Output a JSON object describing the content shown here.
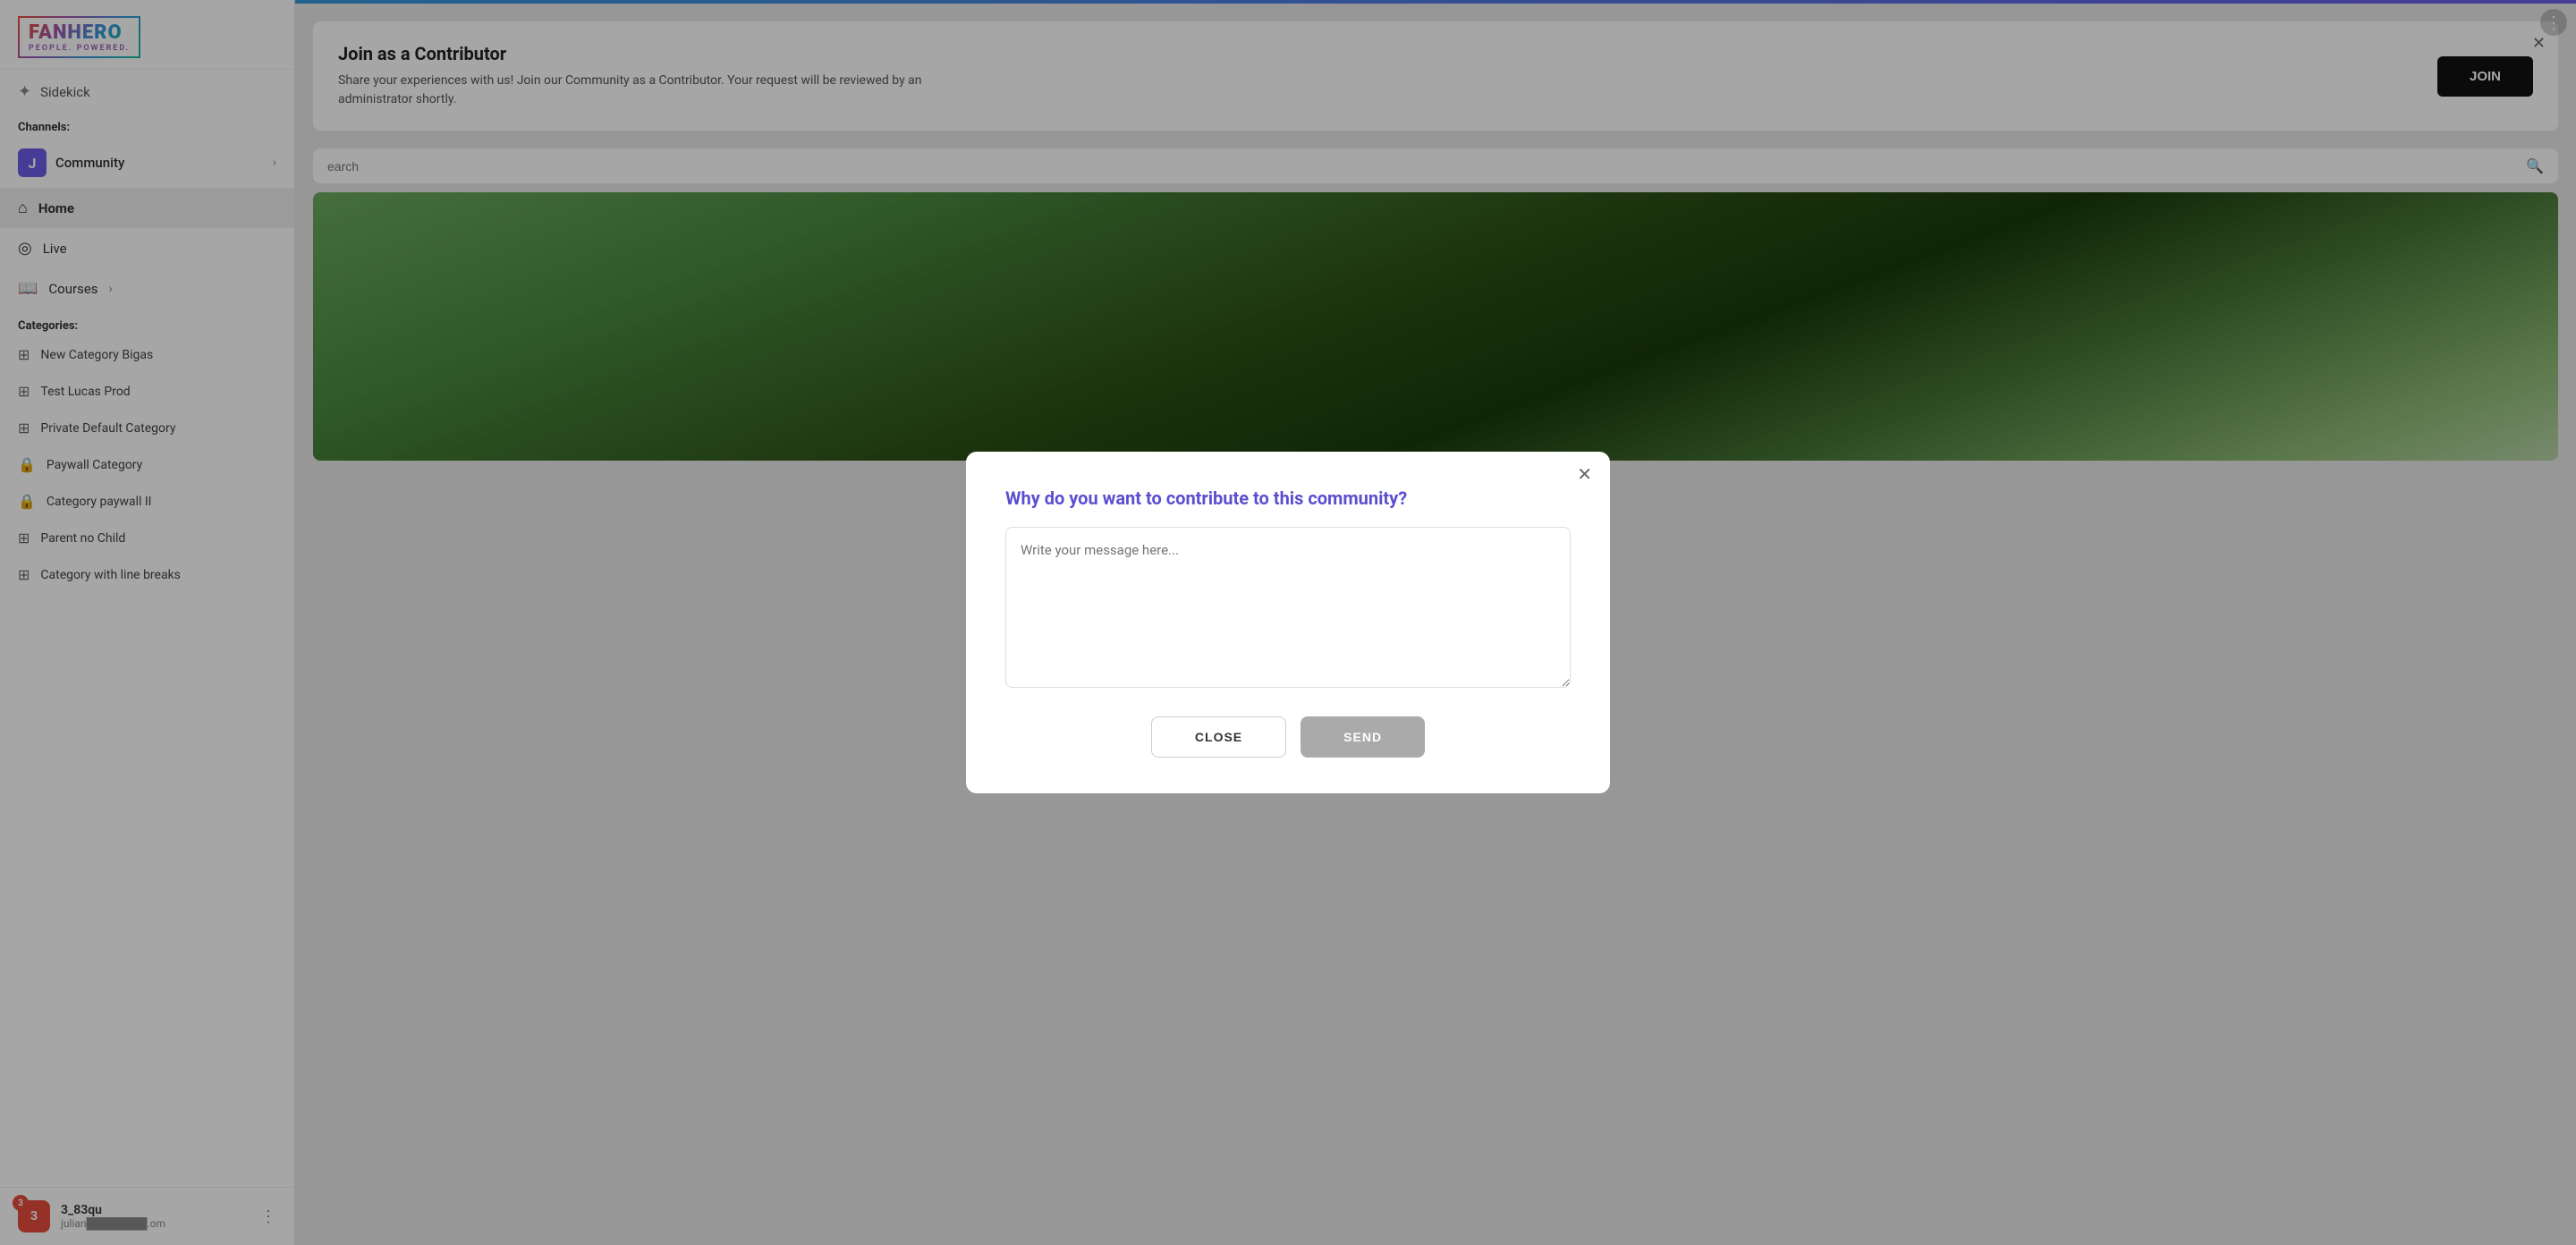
{
  "app": {
    "name": "FANHERO",
    "tagline": "PEOPLE. POWERED."
  },
  "sidebar": {
    "sidekick_label": "Sidekick",
    "channels_label": "Channels:",
    "community": {
      "initial": "J",
      "name": "Community"
    },
    "nav": [
      {
        "label": "Home",
        "icon": "home",
        "active": true
      },
      {
        "label": "Live",
        "icon": "live"
      },
      {
        "label": "Courses",
        "icon": "courses",
        "hasChevron": true
      }
    ],
    "categories_label": "Categories:",
    "categories": [
      {
        "label": "New Category Bigas",
        "icon": "grid",
        "locked": false
      },
      {
        "label": "Test Lucas Prod",
        "icon": "grid",
        "locked": false
      },
      {
        "label": "Private Default Category",
        "icon": "grid",
        "locked": false
      },
      {
        "label": "Paywall Category",
        "icon": "lock",
        "locked": true
      },
      {
        "label": "Category paywall II",
        "icon": "lock",
        "locked": true
      },
      {
        "label": "Parent no Child",
        "icon": "grid",
        "locked": false
      },
      {
        "label": "Category with line breaks",
        "icon": "grid",
        "locked": false
      }
    ],
    "user": {
      "badge_count": "3",
      "initials": "3_83qu",
      "name": "3_83qu",
      "email": "julian████████.om"
    }
  },
  "join_banner": {
    "title": "Join as a Contributor",
    "description": "Share your experiences with us! Join our Community as a Contributor. Your request will be reviewed by an administrator shortly.",
    "button_label": "JOIN"
  },
  "search": {
    "placeholder": "earch"
  },
  "modal": {
    "title": "Why do you want to contribute to this community?",
    "textarea_placeholder": "Write your message here...",
    "close_label": "CLOSE",
    "send_label": "SEND"
  }
}
